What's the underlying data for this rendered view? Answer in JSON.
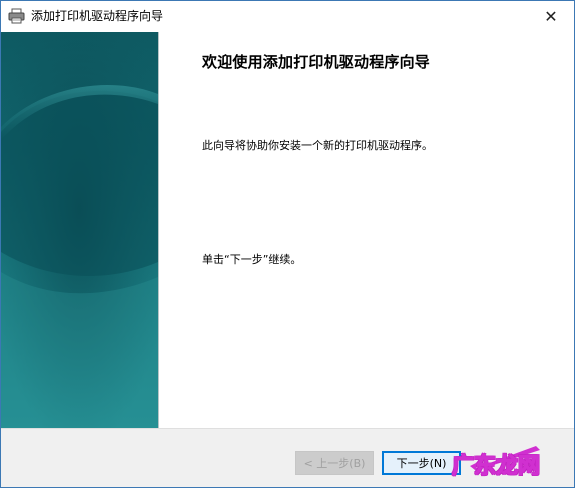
{
  "window": {
    "title": "添加打印机驱动程序向导",
    "icon": "printer-icon",
    "close_glyph": "✕"
  },
  "content": {
    "heading": "欢迎使用添加打印机驱动程序向导",
    "intro": "此向导将协助你安装一个新的打印机驱动程序。",
    "continue_hint": "单击“下一步”继续。"
  },
  "footer": {
    "back_label": "< 上一步(B)",
    "next_label": "下一步(N)"
  },
  "watermark": {
    "text": "广东龙网"
  },
  "colors": {
    "panel_dark": "#0e5a62",
    "panel_light": "#248f94",
    "accent": "#0078d7",
    "watermark": "#d030d0"
  }
}
